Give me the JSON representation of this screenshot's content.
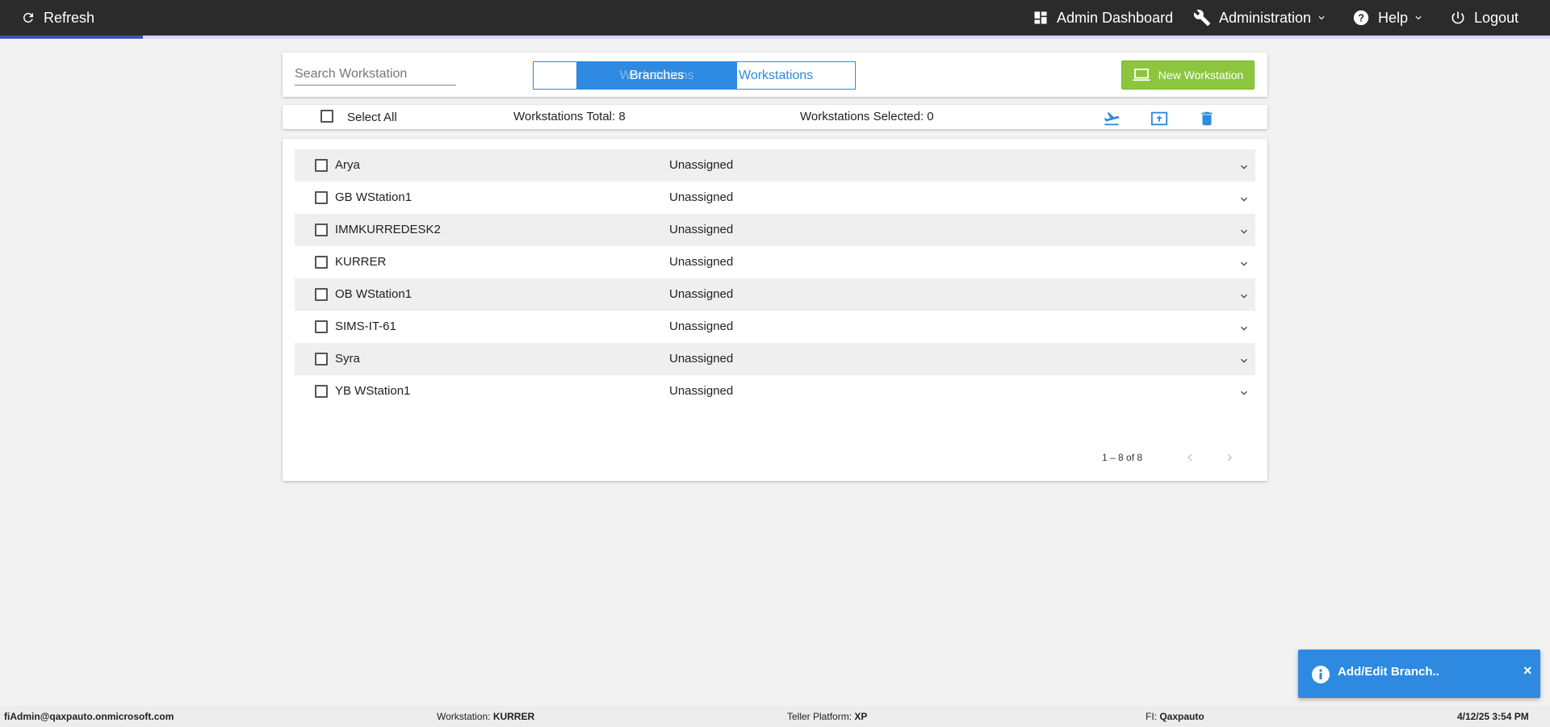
{
  "topbar": {
    "refresh_label": "Refresh",
    "admin_dashboard_label": "Admin Dashboard",
    "administration_label": "Administration",
    "help_label": "Help",
    "logout_label": "Logout",
    "load_progress": 0.092
  },
  "search": {
    "placeholder": "Search Workstation"
  },
  "view_toggle": {
    "branches_label": "Branches",
    "workstations_ghost_label": "Workstations",
    "workstations_label": "Workstations"
  },
  "new_workstation_label": "New Workstation",
  "toolbar": {
    "select_all_label": "Select All",
    "total_label": "Workstations Total: 8",
    "selected_label": "Workstations Selected: 0"
  },
  "workstations": [
    {
      "name": "Arya",
      "status": "Unassigned"
    },
    {
      "name": "GB WStation1",
      "status": "Unassigned"
    },
    {
      "name": "IMMKURREDESK2",
      "status": "Unassigned"
    },
    {
      "name": "KURRER",
      "status": "Unassigned"
    },
    {
      "name": "OB WStation1",
      "status": "Unassigned"
    },
    {
      "name": "SIMS-IT-61",
      "status": "Unassigned"
    },
    {
      "name": "Syra",
      "status": "Unassigned"
    },
    {
      "name": "YB WStation1",
      "status": "Unassigned"
    }
  ],
  "pager": {
    "range_label": "1 – 8 of 8"
  },
  "toast": {
    "message": "Add/Edit Branch..",
    "close": "×"
  },
  "statusbar": {
    "user": "fiAdmin@qaxpauto.onmicrosoft.com",
    "workstation_label": "Workstation:",
    "workstation_value": "KURRER",
    "platform_label": "Teller Platform:",
    "platform_value": "XP",
    "fi_label": "FI:",
    "fi_value": "Qaxpauto",
    "datetime": "4/12/25 3:54 PM"
  },
  "colors": {
    "primary_blue": "#2d8ae0",
    "new_button_green": "#8cc63f",
    "topbar_bg": "#2b2b2b",
    "progress_fill": "#3f51b5"
  },
  "icons": {
    "refresh": "refresh-icon",
    "dashboard": "dashboard-icon",
    "administration": "wrench-icon",
    "help": "help-icon",
    "logout": "power-icon",
    "new_workstation": "laptop-icon",
    "bulk_assign": "flight-takeoff-icon",
    "upload": "upload-icon",
    "delete": "trash-icon",
    "expand": "chevron-down-icon",
    "toast": "info-icon"
  }
}
